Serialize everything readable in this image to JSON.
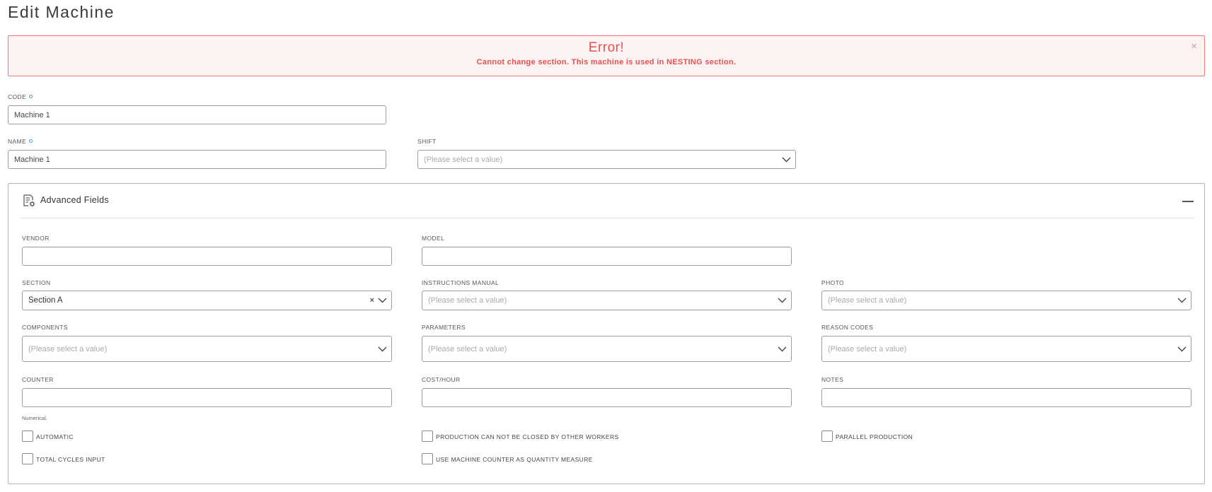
{
  "page": {
    "title": "Edit Machine"
  },
  "alert": {
    "title": "Error!",
    "message": "Cannot change section. This machine is used in NESTING section.",
    "close_label": "×"
  },
  "form": {
    "code": {
      "label": "CODE",
      "value": "Machine 1"
    },
    "name": {
      "label": "NAME",
      "value": "Machine 1"
    },
    "shift": {
      "label": "SHIFT",
      "placeholder": "(Please select a value)"
    }
  },
  "advanced": {
    "title": "Advanced Fields",
    "vendor": {
      "label": "VENDOR",
      "value": ""
    },
    "model": {
      "label": "MODEL",
      "value": ""
    },
    "section": {
      "label": "SECTION",
      "value": "Section A",
      "clear": "×"
    },
    "instructions_manual": {
      "label": "INSTRUCTIONS MANUAL",
      "placeholder": "(Please select a value)"
    },
    "photo": {
      "label": "PHOTO",
      "placeholder": "(Please select a value)"
    },
    "components": {
      "label": "COMPONENTS",
      "placeholder": "(Please select a value)"
    },
    "parameters": {
      "label": "PARAMETERS",
      "placeholder": "(Please select a value)"
    },
    "reason_codes": {
      "label": "REASON CODES",
      "placeholder": "(Please select a value)"
    },
    "counter": {
      "label": "COUNTER",
      "value": "",
      "hint": "Numerical."
    },
    "cost_hour": {
      "label": "COST/HOUR",
      "value": ""
    },
    "notes": {
      "label": "NOTES",
      "value": ""
    },
    "checkboxes": {
      "automatic": {
        "label": "AUTOMATIC",
        "checked": false
      },
      "production_closed": {
        "label": "PRODUCTION CAN NOT BE CLOSED BY OTHER WORKERS",
        "checked": false
      },
      "parallel_production": {
        "label": "PARALLEL PRODUCTION",
        "checked": false
      },
      "total_cycles": {
        "label": "TOTAL CYCLES INPUT",
        "checked": false
      },
      "use_counter": {
        "label": "USE MACHINE COUNTER AS QUANTITY MEASURE",
        "checked": false
      }
    }
  },
  "colors": {
    "error": "#ea4f52",
    "error_bg": "#fdf3f3",
    "required_dot": "#3d9ad6"
  }
}
